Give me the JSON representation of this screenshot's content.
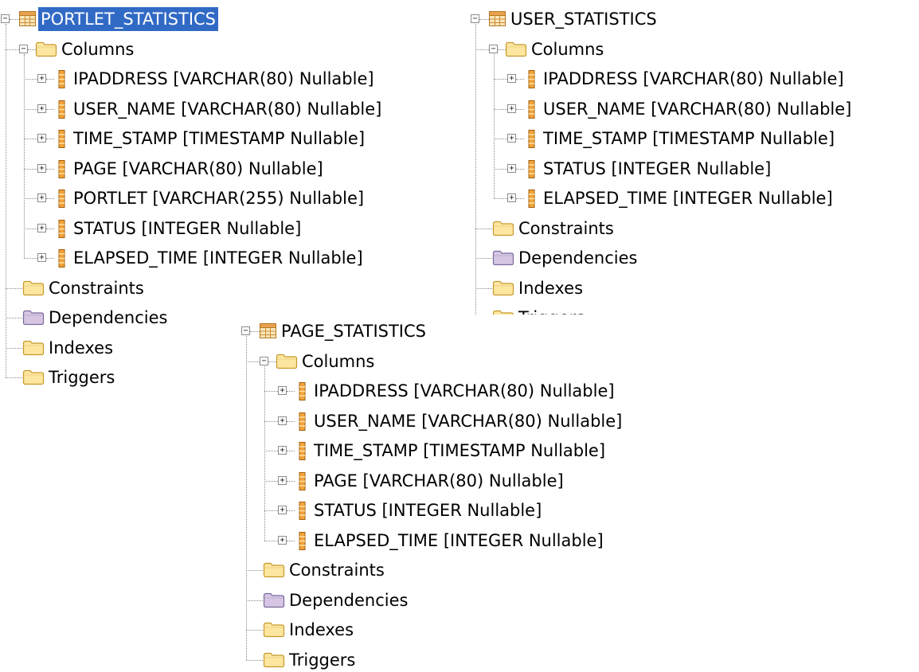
{
  "trees": {
    "portlet": {
      "table_name": "PORTLET_STATISTICS",
      "selected": true,
      "columns_label": "Columns",
      "columns": [
        "IPADDRESS [VARCHAR(80) Nullable]",
        "USER_NAME [VARCHAR(80) Nullable]",
        "TIME_STAMP [TIMESTAMP Nullable]",
        "PAGE [VARCHAR(80) Nullable]",
        "PORTLET [VARCHAR(255) Nullable]",
        "STATUS [INTEGER Nullable]",
        "ELAPSED_TIME [INTEGER Nullable]"
      ],
      "folders": [
        "Constraints",
        "Dependencies",
        "Indexes",
        "Triggers"
      ]
    },
    "user": {
      "table_name": "USER_STATISTICS",
      "selected": false,
      "columns_label": "Columns",
      "columns": [
        "IPADDRESS [VARCHAR(80) Nullable]",
        "USER_NAME [VARCHAR(80) Nullable]",
        "TIME_STAMP [TIMESTAMP Nullable]",
        "STATUS [INTEGER Nullable]",
        "ELAPSED_TIME [INTEGER Nullable]"
      ],
      "folders": [
        "Constraints",
        "Dependencies",
        "Indexes",
        "Triggers"
      ]
    },
    "page": {
      "table_name": "PAGE_STATISTICS",
      "selected": false,
      "columns_label": "Columns",
      "columns": [
        "IPADDRESS [VARCHAR(80) Nullable]",
        "USER_NAME [VARCHAR(80) Nullable]",
        "TIME_STAMP [TIMESTAMP Nullable]",
        "PAGE [VARCHAR(80) Nullable]",
        "STATUS [INTEGER Nullable]",
        "ELAPSED_TIME [INTEGER Nullable]"
      ],
      "folders": [
        "Constraints",
        "Dependencies",
        "Indexes",
        "Triggers"
      ]
    }
  },
  "icons": {
    "table": "table-icon",
    "folder": "folder-icon",
    "dependencies_folder": "dependencies-folder-icon",
    "column": "column-icon",
    "expand": "expand-icon",
    "collapse": "collapse-icon"
  },
  "colors": {
    "selection": "#316ac5",
    "folder_fill": "#fde6a0",
    "folder_stroke": "#c69a2c",
    "dependencies_fill": "#d6c6e4",
    "dependencies_stroke": "#7a6a9a",
    "column_fill": "#f2a33a",
    "table_header": "#e9a24f",
    "table_body": "#fbe7b8"
  }
}
